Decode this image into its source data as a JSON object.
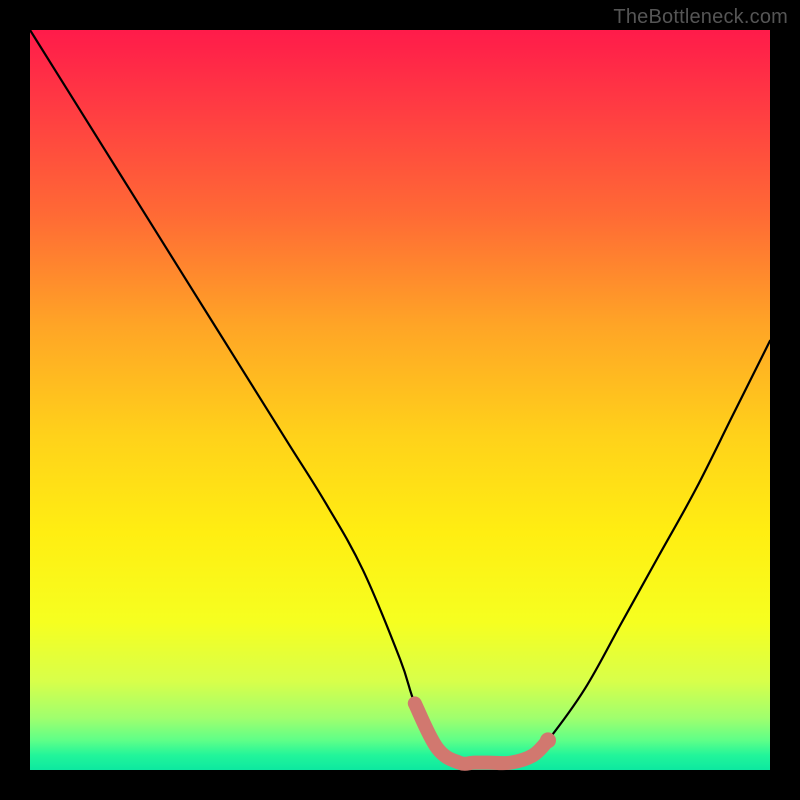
{
  "watermark": "TheBottleneck.com",
  "chart_data": {
    "type": "line",
    "title": "",
    "xlabel": "",
    "ylabel": "",
    "xlim": [
      0,
      100
    ],
    "ylim": [
      0,
      100
    ],
    "series": [
      {
        "name": "bottleneck-curve",
        "x": [
          0,
          5,
          10,
          15,
          20,
          25,
          30,
          35,
          40,
          45,
          50,
          52,
          55,
          58,
          60,
          62,
          65,
          68,
          70,
          75,
          80,
          85,
          90,
          95,
          100
        ],
        "values": [
          100,
          92,
          84,
          76,
          68,
          60,
          52,
          44,
          36,
          27,
          15,
          9,
          3,
          1,
          1,
          1,
          1,
          2,
          4,
          11,
          20,
          29,
          38,
          48,
          58
        ]
      }
    ],
    "highlight": {
      "name": "optimal-range",
      "x": [
        52,
        55,
        58,
        60,
        62,
        65,
        68,
        70
      ],
      "values": [
        9,
        3,
        1,
        1,
        1,
        1,
        2,
        4
      ],
      "color": "#d1786f"
    },
    "gradient_stops": [
      {
        "pos": 0,
        "color": "#ff1b4a"
      },
      {
        "pos": 25,
        "color": "#ff6a35"
      },
      {
        "pos": 55,
        "color": "#ffd21a"
      },
      {
        "pos": 80,
        "color": "#f6ff20"
      },
      {
        "pos": 100,
        "color": "#0de8a0"
      }
    ]
  }
}
